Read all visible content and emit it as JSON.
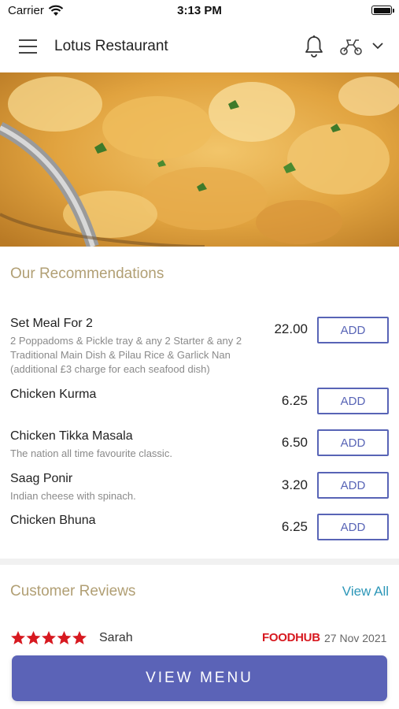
{
  "status": {
    "carrier": "Carrier",
    "time": "3:13 PM"
  },
  "header": {
    "title": "Lotus Restaurant"
  },
  "recommendations": {
    "title": "Our Recommendations",
    "add_label": "ADD",
    "items": [
      {
        "name": "Set Meal For 2",
        "description": "2 Poppadoms & Pickle tray & any 2 Starter & any 2 Traditional Main Dish & Pilau Rice & Garlick Nan (additional £3 charge for each seafood dish)",
        "price": "22.00"
      },
      {
        "name": "Chicken Kurma",
        "description": "",
        "price": "6.25"
      },
      {
        "name": "Chicken Tikka Masala",
        "description": "The nation all time favourite classic.",
        "price": "6.50"
      },
      {
        "name": "Saag Ponir",
        "description": "Indian cheese with spinach.",
        "price": "3.20"
      },
      {
        "name": "Chicken Bhuna",
        "description": "",
        "price": "6.25"
      }
    ]
  },
  "reviews": {
    "title": "Customer Reviews",
    "view_all": "View All",
    "first": {
      "reviewer": "Sarah",
      "rating": 5,
      "source": "FOODHUB",
      "date": "27 Nov 2021"
    }
  },
  "footer": {
    "view_menu": "VIEW MENU"
  },
  "colors": {
    "accent": "#5b63b7",
    "section_title": "#b19f74",
    "link": "#2d97b8",
    "star": "#d71920"
  }
}
